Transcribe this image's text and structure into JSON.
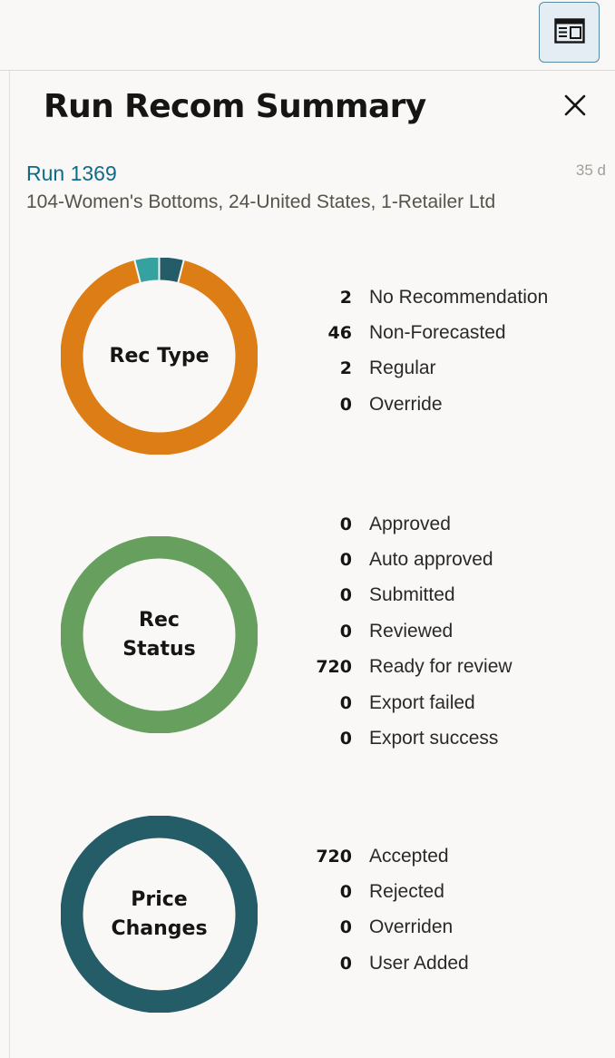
{
  "header": {
    "panel_toggle_icon": "panel-layout-icon"
  },
  "drawer": {
    "title": "Run Recom Summary",
    "close_icon": "close-icon",
    "run_link": "Run 1369",
    "age": "35 d",
    "scope": "104-Women's Bottoms, 24-United States, 1-Retailer Ltd"
  },
  "colors": {
    "orange": "#dc7d15",
    "teal": "#36a2a0",
    "dark_teal": "#245d68",
    "green": "#67a05e",
    "link": "#0f6a8b"
  },
  "rec_type": {
    "label": "Rec Type",
    "items": [
      {
        "count": "2",
        "label": "No Recommendation"
      },
      {
        "count": "46",
        "label": "Non-Forecasted"
      },
      {
        "count": "2",
        "label": "Regular"
      },
      {
        "count": "0",
        "label": "Override"
      }
    ]
  },
  "rec_status": {
    "label": "Rec\nStatus",
    "items": [
      {
        "count": "0",
        "label": "Approved"
      },
      {
        "count": "0",
        "label": "Auto approved"
      },
      {
        "count": "0",
        "label": "Submitted"
      },
      {
        "count": "0",
        "label": "Reviewed"
      },
      {
        "count": "720",
        "label": "Ready for review"
      },
      {
        "count": "0",
        "label": "Export failed"
      },
      {
        "count": "0",
        "label": "Export success"
      }
    ]
  },
  "price_changes": {
    "label": "Price\nChanges",
    "items": [
      {
        "count": "720",
        "label": "Accepted"
      },
      {
        "count": "0",
        "label": "Rejected"
      },
      {
        "count": "0",
        "label": "Overriden"
      },
      {
        "count": "0",
        "label": "User Added"
      }
    ]
  },
  "chart_data": [
    {
      "type": "pie",
      "title": "Rec Type",
      "categories": [
        "No Recommendation",
        "Non-Forecasted",
        "Regular",
        "Override"
      ],
      "values": [
        2,
        46,
        2,
        0
      ],
      "colors": [
        "#245d68",
        "#dc7d15",
        "#36a2a0",
        "#8c8c8c"
      ],
      "start_angle_deg": 0
    },
    {
      "type": "pie",
      "title": "Rec Status",
      "categories": [
        "Approved",
        "Auto approved",
        "Submitted",
        "Reviewed",
        "Ready for review",
        "Export failed",
        "Export success"
      ],
      "values": [
        0,
        0,
        0,
        0,
        720,
        0,
        0
      ],
      "colors": [
        "#245d68",
        "#245d68",
        "#245d68",
        "#245d68",
        "#67a05e",
        "#c74634",
        "#245d68"
      ],
      "start_angle_deg": 0
    },
    {
      "type": "pie",
      "title": "Price Changes",
      "categories": [
        "Accepted",
        "Rejected",
        "Overriden",
        "User Added"
      ],
      "values": [
        720,
        0,
        0,
        0
      ],
      "colors": [
        "#245d68",
        "#c74634",
        "#dc7d15",
        "#67a05e"
      ],
      "start_angle_deg": 0
    }
  ]
}
